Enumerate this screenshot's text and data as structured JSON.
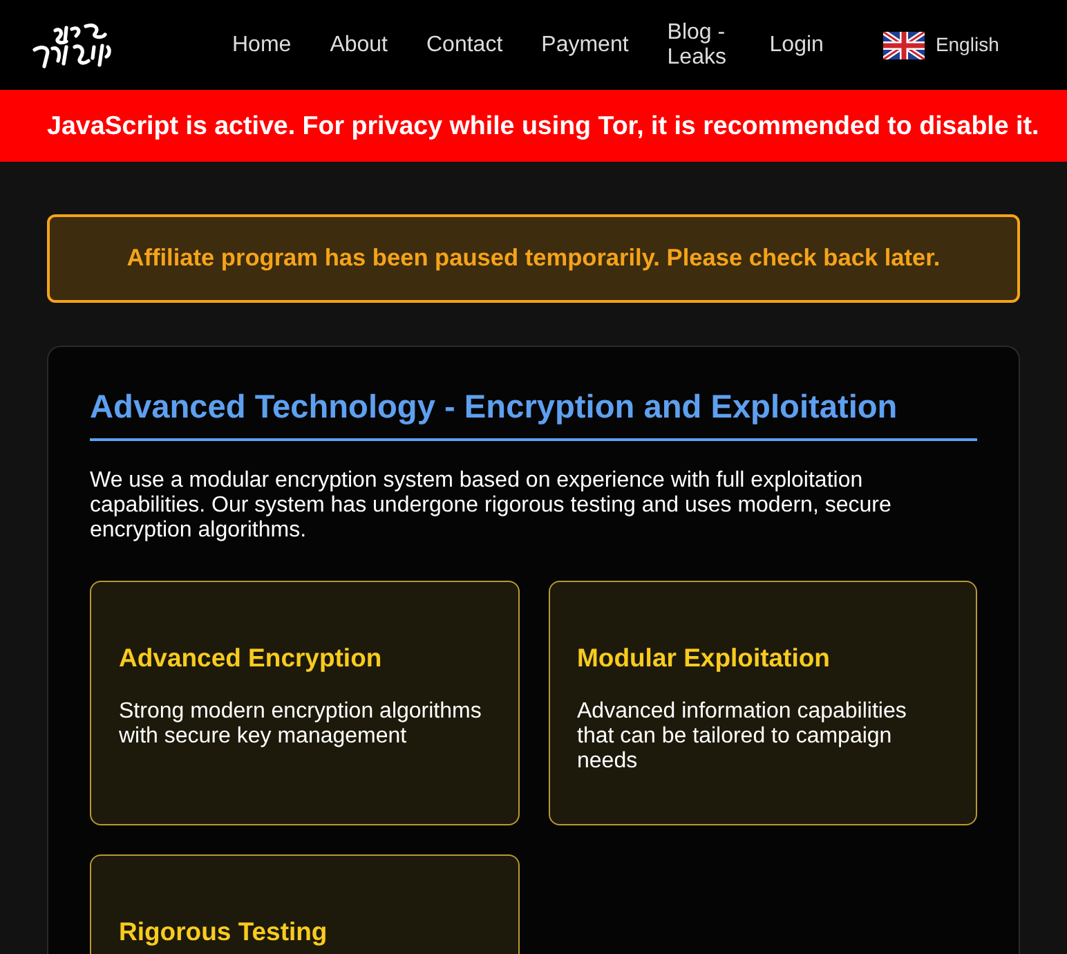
{
  "navbar": {
    "links": [
      {
        "label": "Home"
      },
      {
        "label": "About"
      },
      {
        "label": "Contact"
      },
      {
        "label": "Payment"
      },
      {
        "label": "Blog - Leaks"
      },
      {
        "label": "Login"
      }
    ],
    "language": {
      "label": "English"
    }
  },
  "js_warning": {
    "text": "JavaScript is active. For privacy while using Tor, it is recommended to disable it."
  },
  "notice": {
    "text": "Affiliate program has been paused temporarily. Please check back later."
  },
  "section": {
    "title": "Advanced Technology - Encryption and Exploitation",
    "description": "We use a modular encryption system based on experience with full exploitation capabilities. Our system has undergone rigorous testing and uses modern, secure encryption algorithms.",
    "features": [
      {
        "title": "Advanced Encryption",
        "description": "Strong modern encryption algorithms with secure key management"
      },
      {
        "title": "Modular Exploitation",
        "description": "Advanced information capabilities that can be tailored to campaign needs"
      },
      {
        "title": "Rigorous Testing"
      }
    ]
  }
}
